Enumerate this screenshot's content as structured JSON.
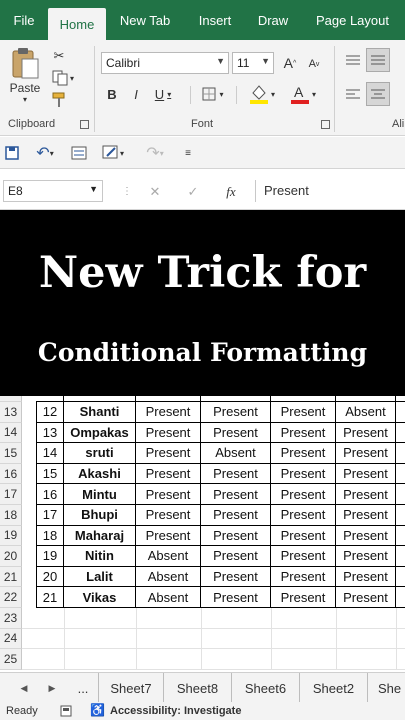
{
  "ribbon_tabs": [
    "File",
    "Home",
    "New Tab",
    "Insert",
    "Draw",
    "Page Layout"
  ],
  "clipboard": {
    "paste_label": "Paste",
    "group_label": "Clipboard"
  },
  "font": {
    "name": "Calibri",
    "size": "11",
    "group_label": "Font",
    "bold": "B",
    "italic": "I",
    "underline": "U",
    "grow": "A",
    "shrink": "A"
  },
  "alignment": {
    "group_label_partial": "Ali"
  },
  "formula_bar": {
    "cell_ref": "E8",
    "fx_label": "fx",
    "cancel": "✕",
    "enter": "✓",
    "value": "Present"
  },
  "banner": {
    "title": "New Trick for",
    "subtitle": "Conditional Formatting"
  },
  "rows": [
    {
      "row": "13",
      "num": "12",
      "name": "Shanti",
      "c": [
        "Present",
        "Present",
        "Present",
        "Absent"
      ]
    },
    {
      "row": "14",
      "num": "13",
      "name": "Ompakas",
      "c": [
        "Present",
        "Present",
        "Present",
        "Present"
      ]
    },
    {
      "row": "15",
      "num": "14",
      "name": "sruti",
      "c": [
        "Present",
        "Absent",
        "Present",
        "Present"
      ]
    },
    {
      "row": "16",
      "num": "15",
      "name": "Akashi",
      "c": [
        "Present",
        "Present",
        "Present",
        "Present"
      ]
    },
    {
      "row": "17",
      "num": "16",
      "name": "Mintu",
      "c": [
        "Present",
        "Present",
        "Present",
        "Present"
      ]
    },
    {
      "row": "18",
      "num": "17",
      "name": "Bhupi",
      "c": [
        "Present",
        "Present",
        "Present",
        "Present"
      ]
    },
    {
      "row": "19",
      "num": "18",
      "name": "Maharaj",
      "c": [
        "Present",
        "Present",
        "Present",
        "Present"
      ]
    },
    {
      "row": "20",
      "num": "19",
      "name": "Nitin",
      "c": [
        "Absent",
        "Present",
        "Present",
        "Present"
      ]
    },
    {
      "row": "21",
      "num": "20",
      "name": "Lalit",
      "c": [
        "Absent",
        "Present",
        "Present",
        "Present"
      ]
    },
    {
      "row": "22",
      "num": "21",
      "name": "Vikas",
      "c": [
        "Absent",
        "Present",
        "Present",
        "Present"
      ]
    }
  ],
  "empty_rows": [
    "23",
    "24",
    "25"
  ],
  "sheet_nav": {
    "prev": "◀",
    "next": "▶",
    "more": "..."
  },
  "sheets": [
    "Sheet7",
    "Sheet8",
    "Sheet6",
    "Sheet2",
    "She"
  ],
  "status": {
    "ready": "Ready",
    "accessibility": "Accessibility: Investigate"
  },
  "colors": {
    "ribbon_green": "#217346",
    "underline_red": "#e02020",
    "highlight_yellow": "#ffe600"
  },
  "icons": [
    "cut-icon",
    "copy-icon",
    "format-painter-icon",
    "paste-icon",
    "borders-icon",
    "fill-color-icon",
    "font-color-icon",
    "save-icon",
    "undo-icon",
    "redo-icon",
    "accessibility-icon"
  ]
}
